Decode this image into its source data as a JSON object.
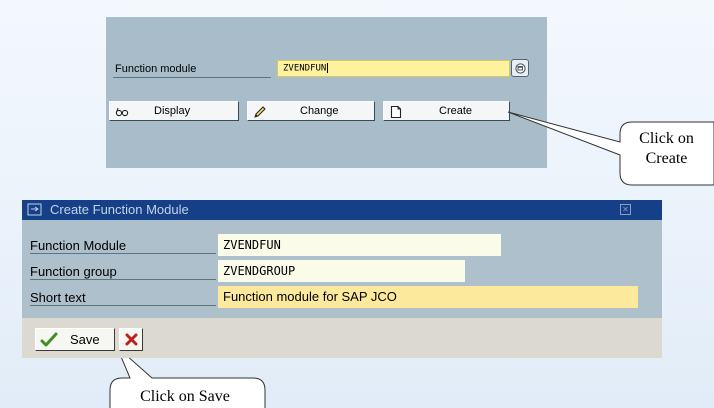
{
  "top_panel": {
    "label": "Function module",
    "input_value": "ZVENDFUN",
    "buttons": {
      "display": "Display",
      "change": "Change",
      "create": "Create"
    }
  },
  "callouts": {
    "create_line1": "Click on",
    "create_line2": "Create",
    "save": "Click on Save"
  },
  "dialog": {
    "title": "Create Function Module",
    "fields": {
      "function_module_label": "Function Module",
      "function_module_value": "ZVENDFUN",
      "function_group_label": "Function group",
      "function_group_value": "ZVENDGROUP",
      "short_text_label": "Short text",
      "short_text_value": "Function module for SAP JCO"
    },
    "toolbar": {
      "save_label": "Save"
    }
  },
  "colors": {
    "title_bar": "#153f87",
    "panel": "#a8bdc9",
    "required_field": "#fce99c",
    "input_field": "#fff29e"
  },
  "icons": [
    "display-glasses-icon",
    "change-pencil-icon",
    "create-page-icon",
    "possible-entries-icon",
    "dialog-window-icon",
    "close-icon",
    "save-checkmark-icon",
    "cancel-x-icon"
  ]
}
